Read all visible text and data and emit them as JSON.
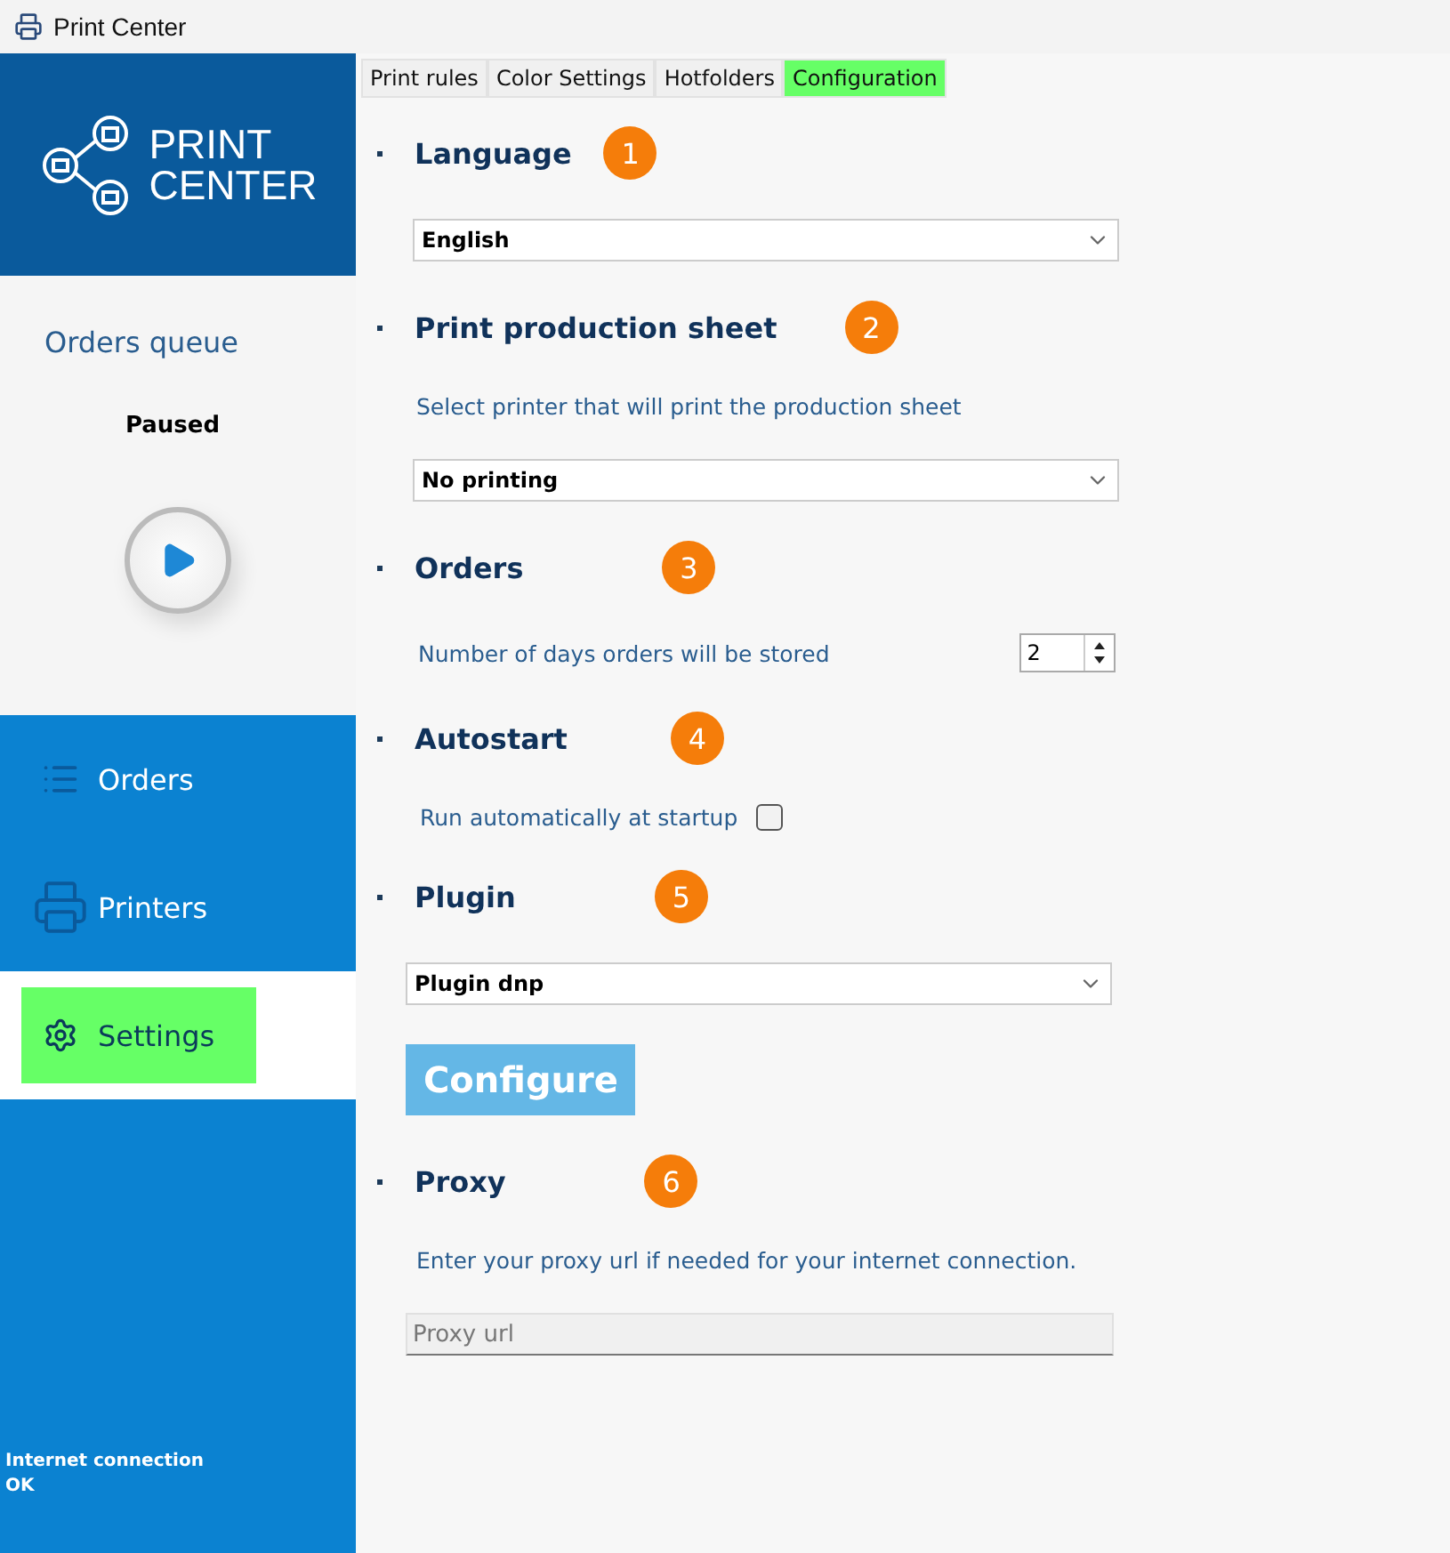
{
  "window": {
    "title": "Print Center"
  },
  "logo": {
    "line_1": "PRINT",
    "line_2": "CENTER"
  },
  "queue": {
    "title": "Orders queue",
    "status": "Paused"
  },
  "nav": [
    {
      "label": "Orders",
      "selected": false
    },
    {
      "label": "Printers",
      "selected": false
    },
    {
      "label": "Settings",
      "selected": true
    }
  ],
  "status": {
    "label": "Internet connection",
    "value": "OK"
  },
  "tabs": [
    {
      "label": "Print rules",
      "selected": false
    },
    {
      "label": "Color Settings",
      "selected": false
    },
    {
      "label": "Hotfolders",
      "selected": false
    },
    {
      "label": "Configuration",
      "selected": true
    }
  ],
  "sections": [
    {
      "title": "Language",
      "badge": "1",
      "items": [
        {
          "kind": "select",
          "value": "English"
        }
      ]
    },
    {
      "title": "Print production sheet",
      "badge": "2",
      "items": [
        {
          "kind": "text",
          "text": "Select printer that will print the production sheet"
        },
        {
          "kind": "select",
          "value": "No printing"
        }
      ]
    },
    {
      "title": "Orders",
      "badge": "3",
      "items": [
        {
          "kind": "number",
          "text": "Number of days orders will be stored",
          "value": "2"
        }
      ]
    },
    {
      "title": "Autostart",
      "badge": "4",
      "items": [
        {
          "kind": "checkbox",
          "text": "Run automatically at startup",
          "checked": false
        }
      ]
    },
    {
      "title": "Plugin",
      "badge": "5",
      "items": [
        {
          "kind": "select",
          "value": "Plugin dnp"
        },
        {
          "kind": "button",
          "label": "Configure"
        }
      ]
    },
    {
      "title": "Proxy",
      "badge": "6",
      "items": [
        {
          "kind": "text",
          "text": "Enter your proxy url if needed for your internet connection."
        },
        {
          "kind": "input",
          "placeholder": "Proxy url"
        }
      ]
    }
  ]
}
